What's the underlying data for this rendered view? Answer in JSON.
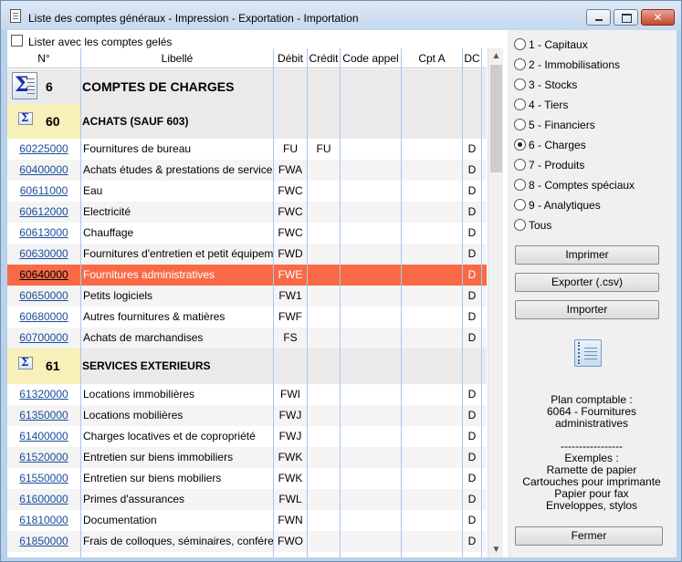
{
  "window": {
    "title": "Liste des comptes généraux - Impression - Exportation - Importation",
    "close_glyph": "✕"
  },
  "frozen_checkbox": {
    "label": "Lister avec les comptes gelés",
    "checked": false
  },
  "grid": {
    "columns": [
      "N°",
      "Libellé",
      "Débit",
      "Crédit",
      "Code appel",
      "Cpt A",
      "DC"
    ],
    "group_6": {
      "num": "6",
      "label": "COMPTES DE CHARGES"
    },
    "group_60": {
      "num": "60",
      "label": "ACHATS (SAUF 603)"
    },
    "group_61": {
      "num": "61",
      "label": "SERVICES EXTERIEURS"
    },
    "rows_60": [
      {
        "num": "60225000",
        "label": "Fournitures de bureau",
        "debit": "FU",
        "credit": "FU",
        "dc": "D"
      },
      {
        "num": "60400000",
        "label": "Achats études & prestations de services",
        "debit": "FWA",
        "credit": "",
        "dc": "D"
      },
      {
        "num": "60611000",
        "label": "Eau",
        "debit": "FWC",
        "credit": "",
        "dc": "D"
      },
      {
        "num": "60612000",
        "label": "Electricité",
        "debit": "FWC",
        "credit": "",
        "dc": "D"
      },
      {
        "num": "60613000",
        "label": "Chauffage",
        "debit": "FWC",
        "credit": "",
        "dc": "D"
      },
      {
        "num": "60630000",
        "label": "Fournitures d'entretien et petit équipement",
        "debit": "FWD",
        "credit": "",
        "dc": "D"
      },
      {
        "num": "60640000",
        "label": "Fournitures administratives",
        "debit": "FWE",
        "credit": "",
        "dc": "D"
      },
      {
        "num": "60650000",
        "label": "Petits logiciels",
        "debit": "FW1",
        "credit": "",
        "dc": "D"
      },
      {
        "num": "60680000",
        "label": "Autres fournitures & matières",
        "debit": "FWF",
        "credit": "",
        "dc": "D"
      },
      {
        "num": "60700000",
        "label": "Achats de marchandises",
        "debit": "FS",
        "credit": "",
        "dc": "D"
      }
    ],
    "rows_61": [
      {
        "num": "61320000",
        "label": "Locations immobilières",
        "debit": "FWI",
        "credit": "",
        "dc": "D"
      },
      {
        "num": "61350000",
        "label": "Locations mobilières",
        "debit": "FWJ",
        "credit": "",
        "dc": "D"
      },
      {
        "num": "61400000",
        "label": "Charges locatives et de copropriété",
        "debit": "FWJ",
        "credit": "",
        "dc": "D"
      },
      {
        "num": "61520000",
        "label": "Entretien sur biens immobiliers",
        "debit": "FWK",
        "credit": "",
        "dc": "D"
      },
      {
        "num": "61550000",
        "label": "Entretien sur biens mobiliers",
        "debit": "FWK",
        "credit": "",
        "dc": "D"
      },
      {
        "num": "61600000",
        "label": "Primes d'assurances",
        "debit": "FWL",
        "credit": "",
        "dc": "D"
      },
      {
        "num": "61810000",
        "label": "Documentation",
        "debit": "FWN",
        "credit": "",
        "dc": "D"
      },
      {
        "num": "61850000",
        "label": "Frais de colloques, séminaires, conférences",
        "debit": "FWO",
        "credit": "",
        "dc": "D"
      }
    ],
    "selected_num": "60640000"
  },
  "classes": {
    "selected": "6 - Charges",
    "options": [
      "1 - Capitaux",
      "2 - Immobilisations",
      "3 - Stocks",
      "4 - Tiers",
      "5 - Financiers",
      "6 - Charges",
      "7 - Produits",
      "8 - Comptes spéciaux",
      "9 - Analytiques",
      "Tous"
    ]
  },
  "buttons": {
    "print": "Imprimer",
    "export": "Exporter (.csv)",
    "import": "Importer",
    "close": "Fermer"
  },
  "info": {
    "line1": "Plan comptable :",
    "line2": "6064 - Fournitures",
    "line3": "administratives",
    "separator": "-----------------",
    "line4": "Exemples  :",
    "line5": "Ramette de papier",
    "line6": "Cartouches pour imprimante",
    "line7": "Papier pour fax",
    "line8": "Enveloppes, stylos"
  },
  "colors": {
    "selection": "#f86a46",
    "link": "#1a4e9c",
    "group_highlight": "#f7f0b8"
  }
}
